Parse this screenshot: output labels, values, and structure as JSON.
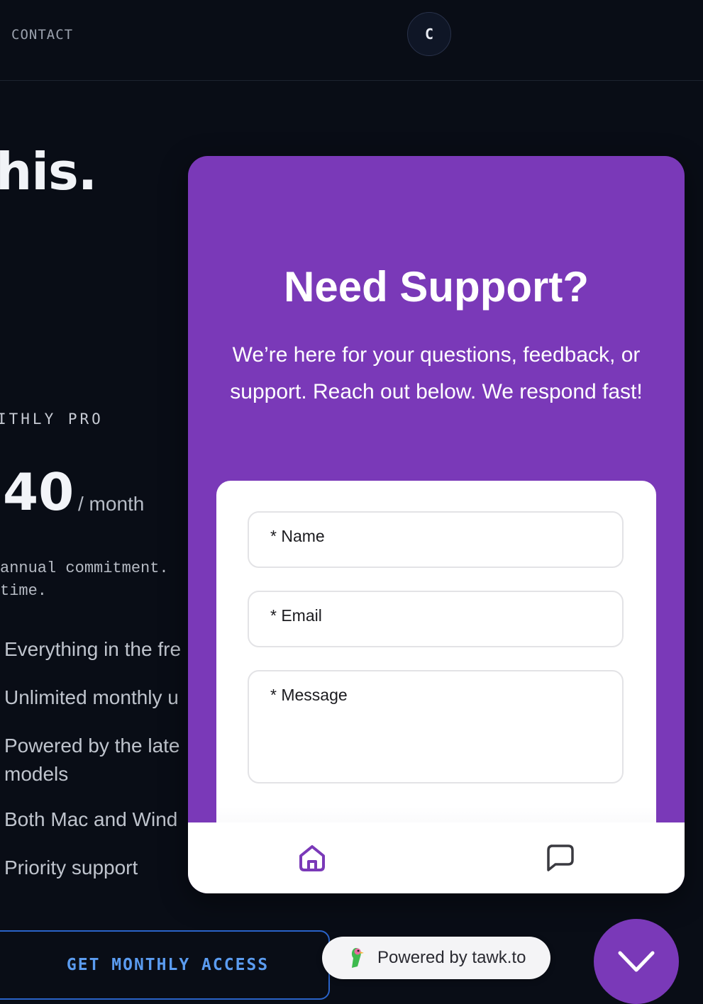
{
  "header": {
    "contact_link": "CONTACT",
    "avatar_initial": "C"
  },
  "hero": {
    "headline_fragment": "his."
  },
  "plan": {
    "label": "ITHLY PRO",
    "price": "40",
    "period": "/ month",
    "terms": "annual commitment.\ntime.",
    "features": [
      "Everything in the fre",
      "Unlimited monthly u",
      "Powered by the late",
      "models",
      "Both Mac and Wind",
      "Priority support"
    ],
    "cta_label": "GET MONTHLY ACCESS"
  },
  "support_widget": {
    "title": "Need Support?",
    "intro": "We’re here for your questions, feedback, or support. Reach out below. We respond fast!",
    "fields": {
      "name_label": "* Name",
      "email_label": "* Email",
      "message_label": "* Message"
    },
    "nav": {
      "home_icon": "home-icon",
      "chat_icon": "chat-icon"
    },
    "powered_by": "Powered by tawk.to",
    "launcher_icon": "chevron-down-icon",
    "accent_color": "#7a39b8"
  }
}
